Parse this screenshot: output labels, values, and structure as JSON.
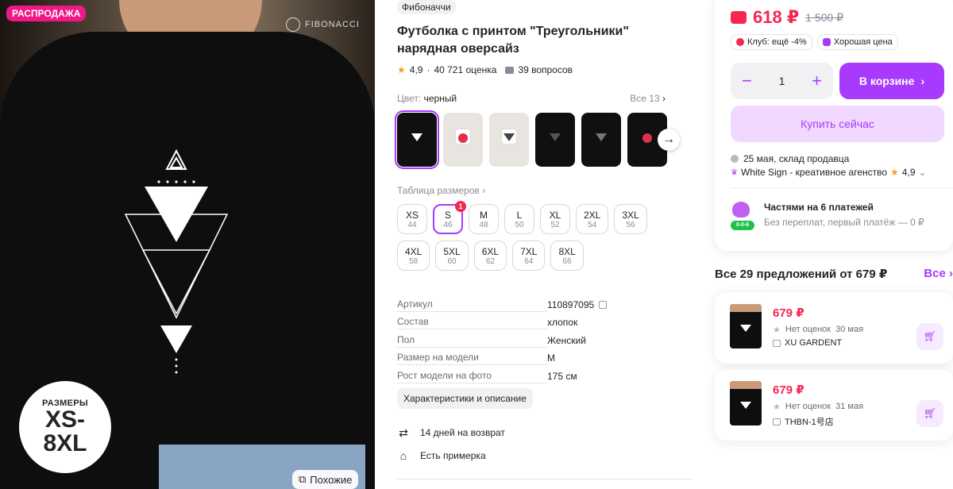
{
  "gallery": {
    "sale_badge": "РАСПРОДАЖА",
    "brand_logo": "FIBONACCI",
    "sizes_label": "РАЗМЕРЫ",
    "sizes_value_1": "XS-",
    "sizes_value_2": "8XL",
    "similar_button": "Похожие"
  },
  "product": {
    "brand_tag": "Фибоначчи",
    "title_line1": "Футболка с принтом \"Треугольники\"",
    "title_line2": "нарядная оверсайз",
    "rating": "4,9",
    "reviews": "40 721 оценка",
    "questions": "39 вопросов",
    "color_label": "Цвет:",
    "color_value": "черный",
    "color_all": "Все 13",
    "size_table_link": "Таблица размеров",
    "sizes": [
      {
        "name": "XS",
        "ru": "44"
      },
      {
        "name": "S",
        "ru": "46",
        "selected": true,
        "count": "1"
      },
      {
        "name": "M",
        "ru": "48"
      },
      {
        "name": "L",
        "ru": "50"
      },
      {
        "name": "XL",
        "ru": "52"
      },
      {
        "name": "2XL",
        "ru": "54"
      },
      {
        "name": "3XL",
        "ru": "56"
      },
      {
        "name": "4XL",
        "ru": "58"
      },
      {
        "name": "5XL",
        "ru": "60"
      },
      {
        "name": "6XL",
        "ru": "62"
      },
      {
        "name": "7XL",
        "ru": "64"
      },
      {
        "name": "8XL",
        "ru": "66"
      }
    ],
    "specs": [
      {
        "key": "Артикул",
        "value": "110897095"
      },
      {
        "key": "Состав",
        "value": "хлопок"
      },
      {
        "key": "Пол",
        "value": "Женский"
      },
      {
        "key": "Размер на модели",
        "value": "M"
      },
      {
        "key": "Рост модели на фото",
        "value": "175 см"
      }
    ],
    "desc_button": "Характеристики и описание",
    "return_info": "14 дней на возврат",
    "fitting_info": "Есть примерка"
  },
  "buy": {
    "price": "618 ₽",
    "old_price": "1 500 ₽",
    "club_chip": "Клуб: ещё -4%",
    "good_price_chip": "Хорошая цена",
    "qty_minus": "−",
    "qty_value": "1",
    "qty_plus": "+",
    "cart_button": "В корзине",
    "buy_now_button": "Купить сейчас",
    "delivery": "25 мая, склад продавца",
    "seller": "White Sign - креативное агенство",
    "seller_rating": "4,9",
    "parts_title": "Частями на 6 платежей",
    "parts_sub": "Без переплат, первый платёж — 0 ₽",
    "parts_badge": "0-0-6"
  },
  "offers": {
    "header": "Все 29 предложений от 679 ₽",
    "all_link": "Все",
    "items": [
      {
        "price": "679 ₽",
        "rating": "Нет оценок",
        "date": "30 мая",
        "seller": "XU GARDENT"
      },
      {
        "price": "679 ₽",
        "rating": "Нет оценок",
        "date": "31 мая",
        "seller": "THBN-1号店"
      }
    ]
  },
  "colors": {
    "accent": "#a73afd",
    "price": "#f5284f",
    "sale": "#f01884"
  }
}
